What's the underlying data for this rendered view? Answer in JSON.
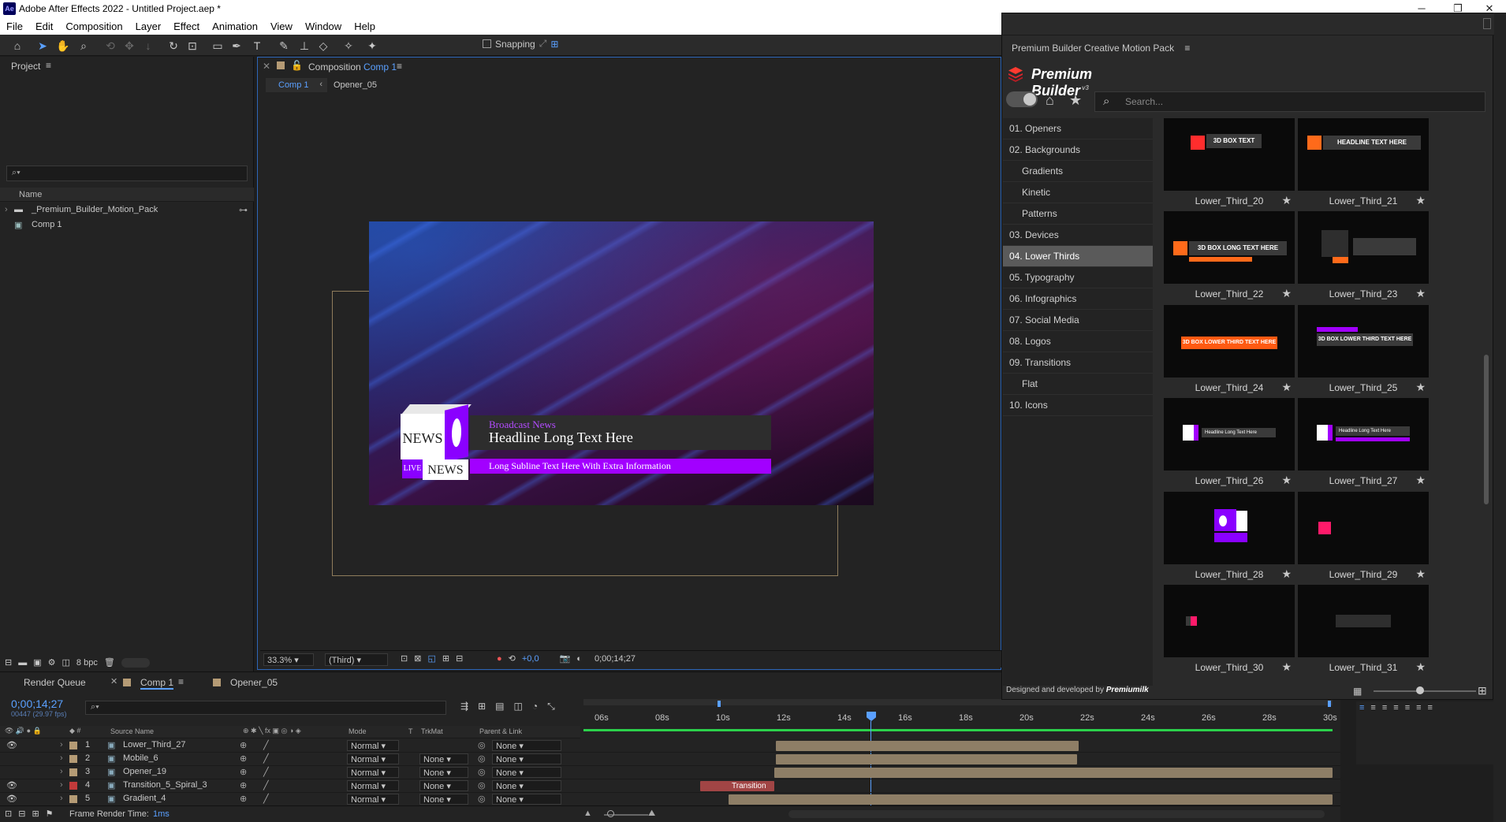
{
  "window": {
    "title": "Adobe After Effects 2022 - Untitled Project.aep *",
    "app_icon": "Ae"
  },
  "menu": [
    "File",
    "Edit",
    "Composition",
    "Layer",
    "Effect",
    "Animation",
    "View",
    "Window",
    "Help"
  ],
  "toolbar": {
    "snapping_label": "Snapping"
  },
  "project": {
    "tab_label": "Project",
    "column_name": "Name",
    "items": [
      {
        "name": "_Premium_Builder_Motion_Pack",
        "icon": "folder-icon"
      },
      {
        "name": "Comp 1",
        "icon": "composition-icon"
      }
    ],
    "bpc": "8 bpc"
  },
  "composition": {
    "panel_prefix": "Composition",
    "comp_name": "Comp 1",
    "breadcrumbs": [
      "Comp 1",
      "Opener_05"
    ],
    "lower_third": {
      "kicker": "Broadcast News",
      "headline": "Headline Long Text Here",
      "subline": "Long Subline Text Here With Extra Information",
      "cube_front": "NEWS",
      "cube_bottom_left": "LIVE",
      "cube_bottom_right": "NEWS"
    },
    "viewer_bar": {
      "zoom": "33.3%",
      "resolution": "(Third)",
      "exposure": "+0,0",
      "timecode": "0;00;14;27"
    }
  },
  "timeline": {
    "tabs": [
      "Render Queue",
      "Comp 1",
      "Opener_05"
    ],
    "timecode": "0;00;14;27",
    "frame_info": "00447 (29.97 fps)",
    "columns": {
      "source_name": "Source Name",
      "mode": "Mode",
      "t": "T",
      "trkmat": "TrkMat",
      "parent": "Parent & Link"
    },
    "ruler": [
      "06s",
      "08s",
      "10s",
      "12s",
      "14s",
      "16s",
      "18s",
      "20s",
      "22s",
      "24s",
      "26s",
      "28s",
      "30s"
    ],
    "layers": [
      {
        "num": "1",
        "name": "Lower_Third_27",
        "mode": "Normal",
        "trkmat": "",
        "parent": "None",
        "color": "#b59b75"
      },
      {
        "num": "2",
        "name": "Mobile_6",
        "mode": "Normal",
        "trkmat": "None",
        "parent": "None",
        "color": "#b59b75"
      },
      {
        "num": "3",
        "name": "Opener_19",
        "mode": "Normal",
        "trkmat": "None",
        "parent": "None",
        "color": "#b59b75"
      },
      {
        "num": "4",
        "name": "Transition_5_Spiral_3",
        "mode": "Normal",
        "trkmat": "None",
        "parent": "None",
        "color": "#c23a3a"
      },
      {
        "num": "5",
        "name": "Gradient_4",
        "mode": "Normal",
        "trkmat": "None",
        "parent": "None",
        "color": "#b59b75"
      }
    ],
    "transition_label": "Transition",
    "status": {
      "label": "Frame Render Time:",
      "value": "1ms"
    }
  },
  "premium_builder": {
    "panel_title": "Premium Builder Creative Motion Pack",
    "brand": "Premium Builder",
    "brand_version": "v3",
    "search_placeholder": "Search...",
    "categories": [
      {
        "label": "01. Openers",
        "sub": false,
        "active": false
      },
      {
        "label": "02. Backgrounds",
        "sub": false,
        "active": false
      },
      {
        "label": "Gradients",
        "sub": true,
        "active": false
      },
      {
        "label": "Kinetic",
        "sub": true,
        "active": false
      },
      {
        "label": "Patterns",
        "sub": true,
        "active": false
      },
      {
        "label": "03. Devices",
        "sub": false,
        "active": false
      },
      {
        "label": "04. Lower Thirds",
        "sub": false,
        "active": true
      },
      {
        "label": "05. Typography",
        "sub": false,
        "active": false
      },
      {
        "label": "06. Infographics",
        "sub": false,
        "active": false
      },
      {
        "label": "07. Social Media",
        "sub": false,
        "active": false
      },
      {
        "label": "08. Logos",
        "sub": false,
        "active": false
      },
      {
        "label": "09. Transitions",
        "sub": false,
        "active": false
      },
      {
        "label": "Flat",
        "sub": true,
        "active": false
      },
      {
        "label": "10. Icons",
        "sub": false,
        "active": false
      }
    ],
    "items": [
      {
        "label": "Lower_Third_20",
        "thumb_text": "3D BOX TEXT"
      },
      {
        "label": "Lower_Third_21",
        "thumb_text": "HEADLINE TEXT HERE"
      },
      {
        "label": "Lower_Third_22",
        "thumb_text": "3D BOX LONG TEXT HERE"
      },
      {
        "label": "Lower_Third_23",
        "thumb_text": ""
      },
      {
        "label": "Lower_Third_24",
        "thumb_text": "3D BOX LOWER THIRD TEXT HERE"
      },
      {
        "label": "Lower_Third_25",
        "thumb_text": "3D BOX LOWER THIRD TEXT HERE"
      },
      {
        "label": "Lower_Third_26",
        "thumb_text": "Headline Long Text Here"
      },
      {
        "label": "Lower_Third_27",
        "thumb_text": "Headline Long Text Here"
      },
      {
        "label": "Lower_Third_28",
        "thumb_text": ""
      },
      {
        "label": "Lower_Third_29",
        "thumb_text": ""
      },
      {
        "label": "Lower_Third_30",
        "thumb_text": ""
      },
      {
        "label": "Lower_Third_31",
        "thumb_text": ""
      }
    ],
    "footer": "Designed and developed by",
    "footer_brand": "Premiumilk"
  }
}
